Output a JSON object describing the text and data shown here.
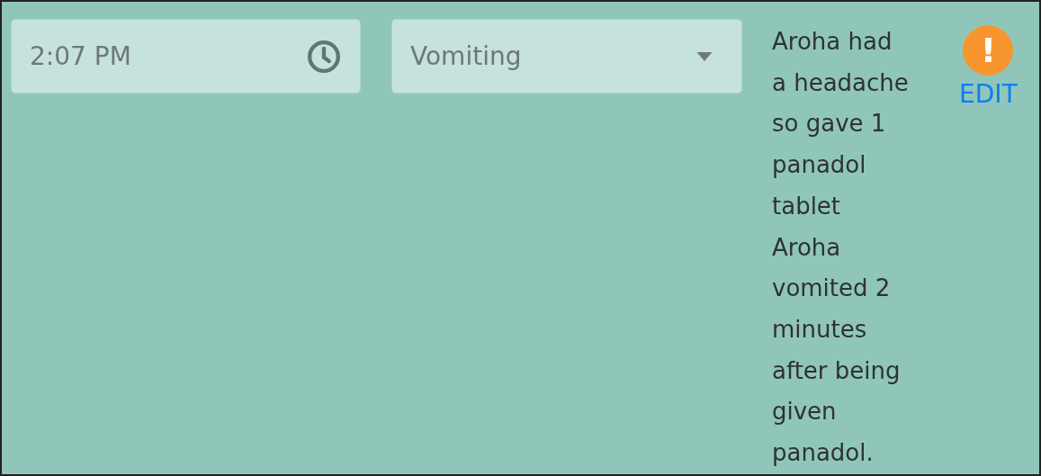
{
  "time_field": {
    "value": "2:07 PM"
  },
  "type_dropdown": {
    "value": "Vomiting"
  },
  "note": [
    "Aroha had a headache so gave 1 panadol tablet",
    "Aroha vomited 2 minutes after being given panadol."
  ],
  "alert": {
    "kind": "warning",
    "symbol": "!"
  },
  "edit_link": "EDIT"
}
